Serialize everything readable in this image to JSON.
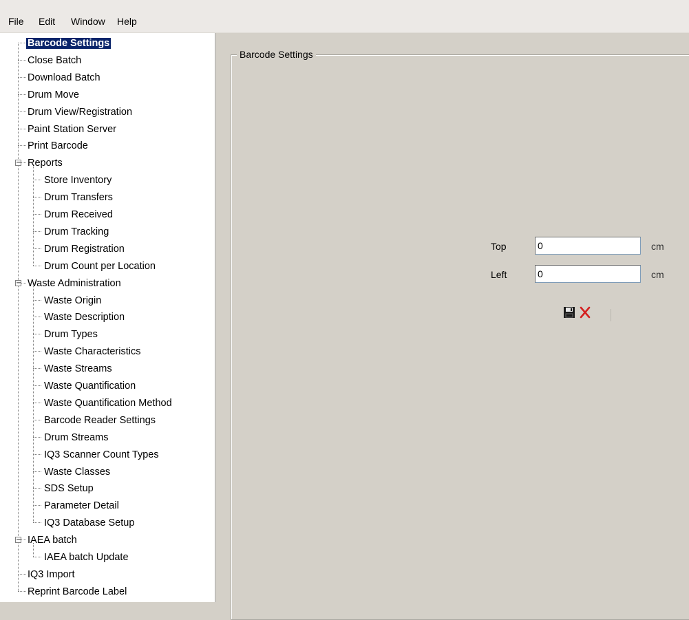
{
  "menu": [
    "File",
    "Edit",
    "Window",
    "Help"
  ],
  "tree": [
    {
      "label": "Barcode Settings",
      "level": 0,
      "selected": true
    },
    {
      "label": "Close Batch",
      "level": 0
    },
    {
      "label": "Download Batch",
      "level": 0
    },
    {
      "label": "Drum Move",
      "level": 0
    },
    {
      "label": "Drum View/Registration",
      "level": 0
    },
    {
      "label": "Paint Station Server",
      "level": 0
    },
    {
      "label": "Print Barcode",
      "level": 0
    },
    {
      "label": "Reports",
      "level": 0,
      "expanded": true
    },
    {
      "label": "Store Inventory",
      "level": 1
    },
    {
      "label": "Drum Transfers",
      "level": 1
    },
    {
      "label": "Drum Received",
      "level": 1
    },
    {
      "label": "Drum Tracking",
      "level": 1
    },
    {
      "label": "Drum Registration",
      "level": 1
    },
    {
      "label": "Drum Count per Location",
      "level": 1
    },
    {
      "label": "Waste Administration",
      "level": 0,
      "expanded": true
    },
    {
      "label": "Waste Origin",
      "level": 1
    },
    {
      "label": "Waste Description",
      "level": 1
    },
    {
      "label": "Drum Types",
      "level": 1
    },
    {
      "label": "Waste Characteristics",
      "level": 1
    },
    {
      "label": "Waste Streams",
      "level": 1
    },
    {
      "label": "Waste Quantification",
      "level": 1
    },
    {
      "label": "Waste Quantification Method",
      "level": 1
    },
    {
      "label": "Barcode Reader Settings",
      "level": 1
    },
    {
      "label": "Drum Streams",
      "level": 1
    },
    {
      "label": "IQ3 Scanner Count Types",
      "level": 1
    },
    {
      "label": "Waste Classes",
      "level": 1
    },
    {
      "label": "SDS Setup",
      "level": 1
    },
    {
      "label": "Parameter Detail",
      "level": 1
    },
    {
      "label": "IQ3 Database Setup",
      "level": 1
    },
    {
      "label": "IAEA batch",
      "level": 0,
      "expanded": true
    },
    {
      "label": "IAEA batch Update",
      "level": 1
    },
    {
      "label": "IQ3 Import",
      "level": 0
    },
    {
      "label": "Reprint Barcode Label",
      "level": 0
    }
  ],
  "panel": {
    "title": "Barcode Settings",
    "top_label": "Top",
    "top_value": "0",
    "top_unit": "cm",
    "left_label": "Left",
    "left_value": "0",
    "left_unit": "cm",
    "save_icon": "save-icon",
    "cancel_icon": "cancel-icon"
  },
  "colors": {
    "selection": "#0a246a",
    "cancel": "#d42020"
  }
}
